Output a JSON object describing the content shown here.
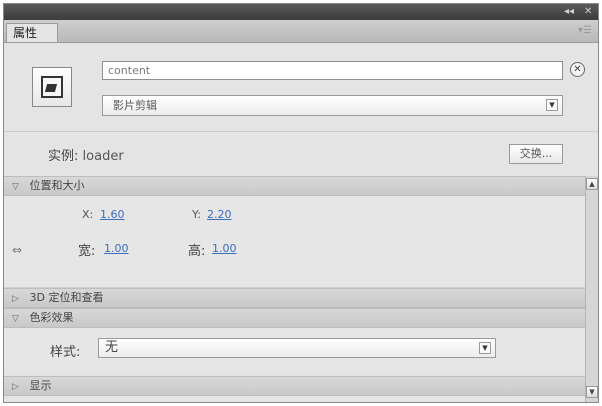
{
  "window": {
    "controls": [
      "◂◂",
      "✕"
    ]
  },
  "tab": {
    "label": "属性",
    "menu_icon": "panel-menu-icon"
  },
  "header": {
    "symbol_icon": "movie-clip-symbol-icon",
    "instance_name_value": "content",
    "clear_icon": "close-icon",
    "symbol_type": "影片剪辑",
    "dropdown_icon": "chevron-down-icon"
  },
  "instance": {
    "label": "实例:",
    "name": "loader",
    "swap_label": "交换..."
  },
  "sections": {
    "position": {
      "title": "位置和大小",
      "x_label": "X:",
      "x_value": "1.60",
      "y_label": "Y:",
      "y_value": "2.20",
      "width_label": "宽:",
      "width_value": "1.00",
      "height_label": "高:",
      "height_value": "1.00",
      "link_icon": "link-icon"
    },
    "three_d": {
      "title": "3D 定位和查看"
    },
    "color": {
      "title": "色彩效果",
      "style_label": "样式:",
      "style_value": "无"
    },
    "filter": {
      "title": "显示"
    }
  },
  "scrollbar": {
    "up_icon": "scroll-up-icon",
    "down_icon": "scroll-down-icon"
  }
}
